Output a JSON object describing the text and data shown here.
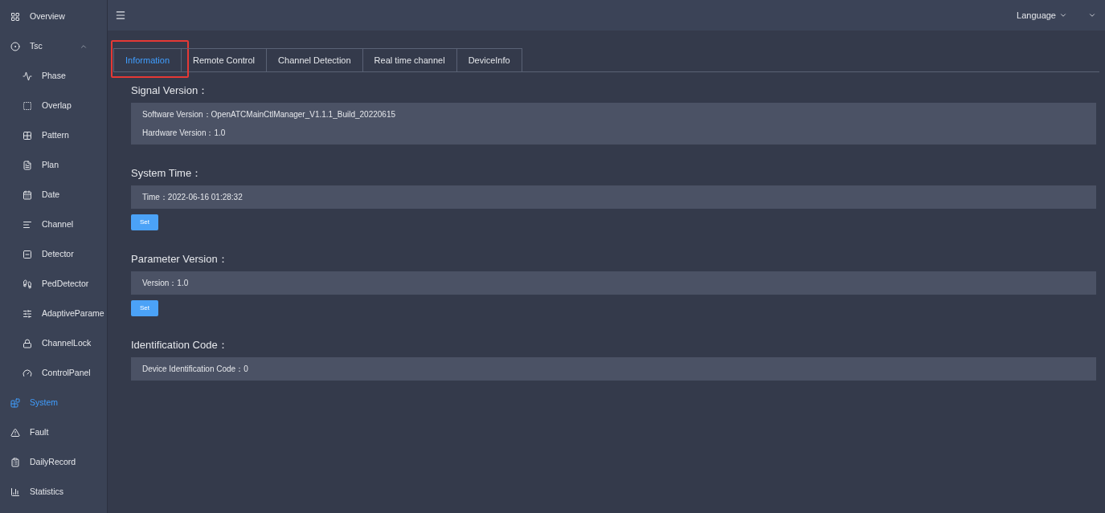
{
  "sidebar": {
    "items": [
      {
        "label": "Overview",
        "selected": false
      },
      {
        "label": "Tsc",
        "selected": false,
        "expanded": true,
        "children": [
          {
            "label": "Phase",
            "selected": false
          },
          {
            "label": "Overlap",
            "selected": false
          },
          {
            "label": "Pattern",
            "selected": false
          },
          {
            "label": "Plan",
            "selected": false
          },
          {
            "label": "Date",
            "selected": false
          },
          {
            "label": "Channel",
            "selected": false
          },
          {
            "label": "Detector",
            "selected": false
          },
          {
            "label": "PedDetector",
            "selected": false
          },
          {
            "label": "AdaptiveParame",
            "selected": false
          },
          {
            "label": "ChannelLock",
            "selected": false
          },
          {
            "label": "ControlPanel",
            "selected": false
          }
        ]
      },
      {
        "label": "System",
        "selected": true
      },
      {
        "label": "Fault",
        "selected": false
      },
      {
        "label": "DailyRecord",
        "selected": false
      },
      {
        "label": "Statistics",
        "selected": false
      }
    ]
  },
  "header": {
    "language": "Language"
  },
  "tabs": [
    {
      "label": "Information",
      "selected": true,
      "highlighted": true
    },
    {
      "label": "Remote Control",
      "selected": false,
      "highlighted": false
    },
    {
      "label": "Channel Detection",
      "selected": false,
      "highlighted": false
    },
    {
      "label": "Real time channel",
      "selected": false,
      "highlighted": false
    },
    {
      "label": "DeviceInfo",
      "selected": false,
      "highlighted": false
    }
  ],
  "sections": [
    {
      "title": "Signal Version：",
      "rows": [
        "Software Version：OpenATCMainCtlManager_V1.1.1_Build_20220615",
        "Hardware Version：1.0"
      ]
    },
    {
      "title": "System Time：",
      "rows": [
        "Time：2022-06-16 01:28:32"
      ],
      "button": "Set"
    },
    {
      "title": "Parameter Version：",
      "rows": [
        "Version：1.0"
      ],
      "button": "Set"
    },
    {
      "title": "Identification Code：",
      "rows": [
        "Device Identification Code：0"
      ]
    }
  ]
}
